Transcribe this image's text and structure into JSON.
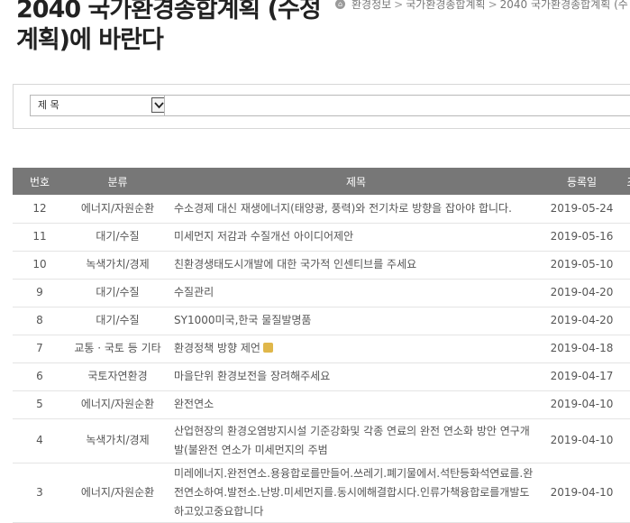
{
  "page": {
    "title": "2040 국가환경종합계획 (수정계획)에 바란다"
  },
  "breadcrumb": {
    "home_icon": "home-icon",
    "items": [
      "환경정보",
      "국가환경종합계획",
      "2040 국가환경종합계획 (수"
    ]
  },
  "search": {
    "field_selected": "제 목",
    "input_value": ""
  },
  "table": {
    "headers": [
      "번호",
      "분류",
      "제목",
      "등록일",
      "조"
    ],
    "rows": [
      {
        "num": "12",
        "category": "에너지/자원순환",
        "title": "수소경제 대신 재생에너지(태양광, 풍력)와 전기차로 방향을 잡아야 합니다.",
        "date": "2019-05-24",
        "locked": false
      },
      {
        "num": "11",
        "category": "대기/수질",
        "title": "미세먼지 저감과 수질개선 아이디어제안",
        "date": "2019-05-16",
        "locked": false
      },
      {
        "num": "10",
        "category": "녹색가치/경제",
        "title": "친환경생태도시개발에 대한 국가적 인센티브를 주세요",
        "date": "2019-05-10",
        "locked": false
      },
      {
        "num": "9",
        "category": "대기/수질",
        "title": "수질관리",
        "date": "2019-04-20",
        "locked": false
      },
      {
        "num": "8",
        "category": "대기/수질",
        "title": "SY1000미국,한국 물질발명품",
        "date": "2019-04-20",
        "locked": false
      },
      {
        "num": "7",
        "category": "교통 · 국토 등 기타",
        "title": "환경정책 방향 제언",
        "date": "2019-04-18",
        "locked": true
      },
      {
        "num": "6",
        "category": "국토자연환경",
        "title": "마을단위 환경보전을 장려해주세요",
        "date": "2019-04-17",
        "locked": false
      },
      {
        "num": "5",
        "category": "에너지/자원순환",
        "title": "완전연소",
        "date": "2019-04-10",
        "locked": false
      },
      {
        "num": "4",
        "category": "녹색가치/경제",
        "title": "산업현장의 환경오염방지시설 기준강화및 각종 연료의 완전 연소화 방안 연구개발(불완전 연소가 미세먼지의 주범",
        "date": "2019-04-10",
        "locked": false
      },
      {
        "num": "3",
        "category": "에너지/자원순환",
        "title": "미레에너지.완전연소.용융합로를만들어.쓰레기.폐기물에서.석탄등화석연료를.완전연소하여.발전소.난방.미세먼지를.동시에해결합시다.인류가책융합로를개발도하고있고중요합니다",
        "date": "2019-04-10",
        "locked": false
      }
    ]
  }
}
